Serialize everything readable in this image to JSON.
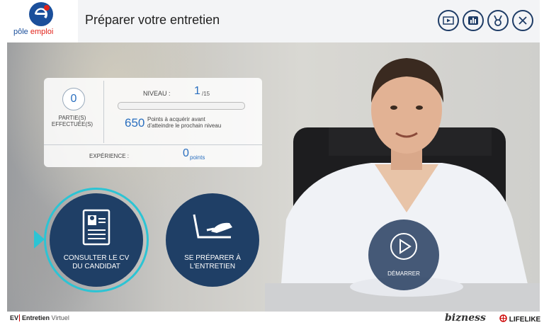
{
  "header": {
    "logo_text_a": "pôle ",
    "logo_text_b": "emploi",
    "title": "Préparer votre entretien",
    "buttons": [
      {
        "icon": "video-icon"
      },
      {
        "icon": "stats-icon"
      },
      {
        "icon": "medal-icon"
      },
      {
        "icon": "close-icon"
      }
    ]
  },
  "stats": {
    "parties_value": "0",
    "parties_label_1": "PARTIE(S)",
    "parties_label_2": "EFFECTUÉE(S)",
    "niveau_label": "NIVEAU :",
    "niveau_value": "1",
    "niveau_total": "/15",
    "progress_fraction": 0.0,
    "points_value": "650",
    "points_text_1": "Points à acquérir avant",
    "points_text_2": "d'atteindre le prochain niveau",
    "experience_label": "EXPÉRIENCE :",
    "experience_value": "0",
    "experience_unit": "points"
  },
  "actions": {
    "cv_label_1": "CONSULTER LE CV",
    "cv_label_2": "DU CANDIDAT",
    "prep_label_1": "SE PRÉPARER À",
    "prep_label_2": "L'ENTRETIEN",
    "play_label": "DÉMARRER"
  },
  "footer": {
    "ev_mark": "EV",
    "ev_bold": "Entretien",
    "ev_light": "Virtuel",
    "brand_1": "bizness",
    "brand_2": "LIFELIKE"
  },
  "colors": {
    "accent": "#2cc4d4",
    "button_dark": "#1f3f66",
    "value_blue": "#2a6fbf"
  }
}
